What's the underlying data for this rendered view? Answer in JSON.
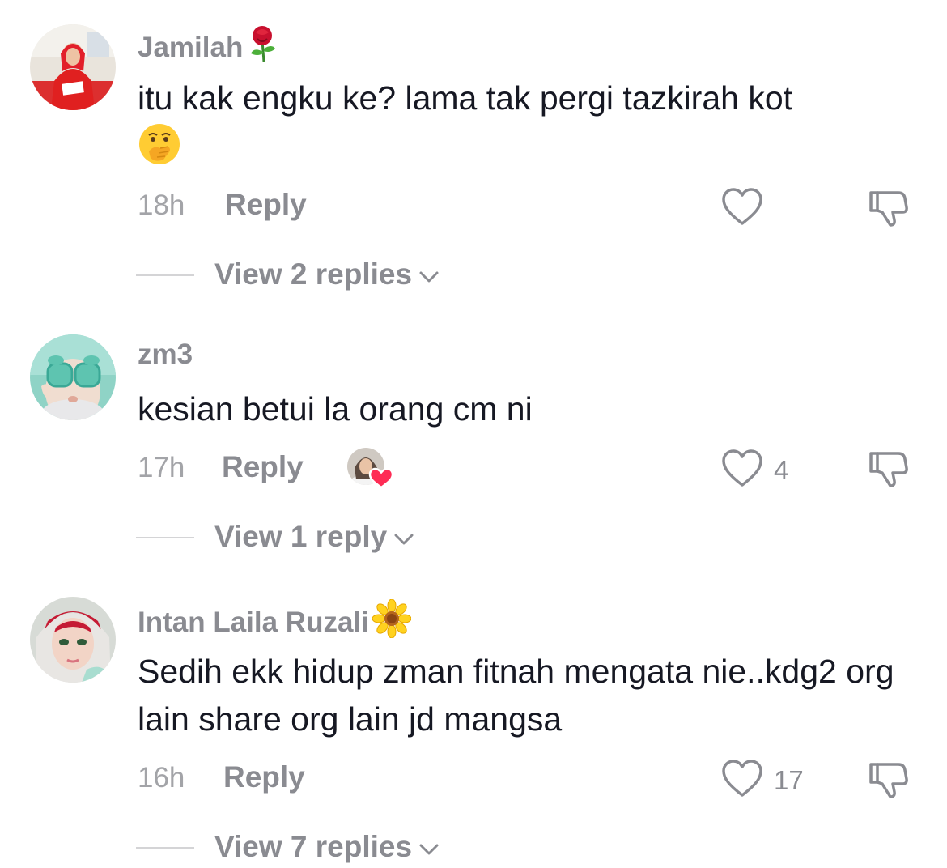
{
  "comments": [
    {
      "username": "Jamilah",
      "username_emoji": "rose",
      "text": "itu kak engku ke? lama tak pergi tazkirah kot",
      "text_emoji": "face-with-hand-over-mouth",
      "time": "18h",
      "reply_label": "Reply",
      "like_count": "",
      "view_replies": "View 2 replies"
    },
    {
      "username": "zm3",
      "username_emoji": "",
      "text": "kesian betui la orang cm ni",
      "text_emoji": "",
      "time": "17h",
      "reply_label": "Reply",
      "creator_liked": true,
      "like_count": "4",
      "view_replies": "View 1 reply"
    },
    {
      "username": "Intan Laila Ruzali",
      "username_emoji": "sunflower",
      "text": "Sedih ekk hidup zman fitnah mengata nie..kdg2 org lain share org lain jd mangsa",
      "text_emoji": "",
      "time": "16h",
      "reply_label": "Reply",
      "like_count": "17",
      "view_replies": "View 7 replies"
    }
  ],
  "icons": {
    "like": "heart-outline-icon",
    "dislike": "thumbs-down-icon",
    "expand": "chevron-down-icon"
  },
  "colors": {
    "username": "#8a8b91",
    "text": "#161823",
    "meta": "#a3a4a8",
    "heart_badge": "#fe2c55"
  }
}
